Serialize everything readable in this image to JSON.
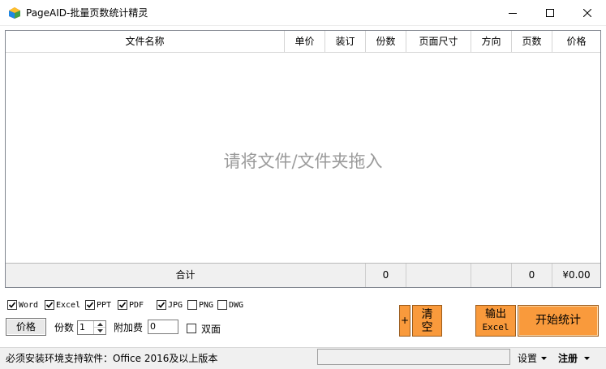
{
  "window": {
    "title": "PageAID-批量页数统计精灵"
  },
  "table": {
    "columns": [
      "文件名称",
      "单价",
      "装订",
      "份数",
      "页面尺寸",
      "方向",
      "页数",
      "价格"
    ],
    "empty_hint": "请将文件/文件夹拖入",
    "footer": {
      "label": "合计",
      "copies_total": "0",
      "pages_total": "0",
      "price_total": "¥0.00"
    }
  },
  "formats": [
    {
      "label": "Word",
      "checked": true
    },
    {
      "label": "Excel",
      "checked": true
    },
    {
      "label": "PPT",
      "checked": true
    },
    {
      "label": "PDF",
      "checked": true
    },
    {
      "label": "JPG",
      "checked": true
    },
    {
      "label": "PNG",
      "checked": false
    },
    {
      "label": "DWG",
      "checked": false
    }
  ],
  "controls": {
    "price_button": "价格",
    "copies_label": "份数",
    "copies_value": "1",
    "surcharge_label": "附加费",
    "surcharge_value": "0",
    "duplex_label": "双面",
    "duplex_checked": false,
    "plus_label": "+",
    "clear_label_line1": "清",
    "clear_label_line2": "空",
    "export_label_line1": "输出",
    "export_label_line2": "Excel",
    "start_label": "开始统计"
  },
  "statusbar": {
    "message": "必须安装环境支持软件：Office 2016及以上版本",
    "settings_label": "设置",
    "register_label": "注册"
  },
  "colors": {
    "accent_orange": "#f99a3c",
    "hint_gray": "#9a9a9a"
  }
}
